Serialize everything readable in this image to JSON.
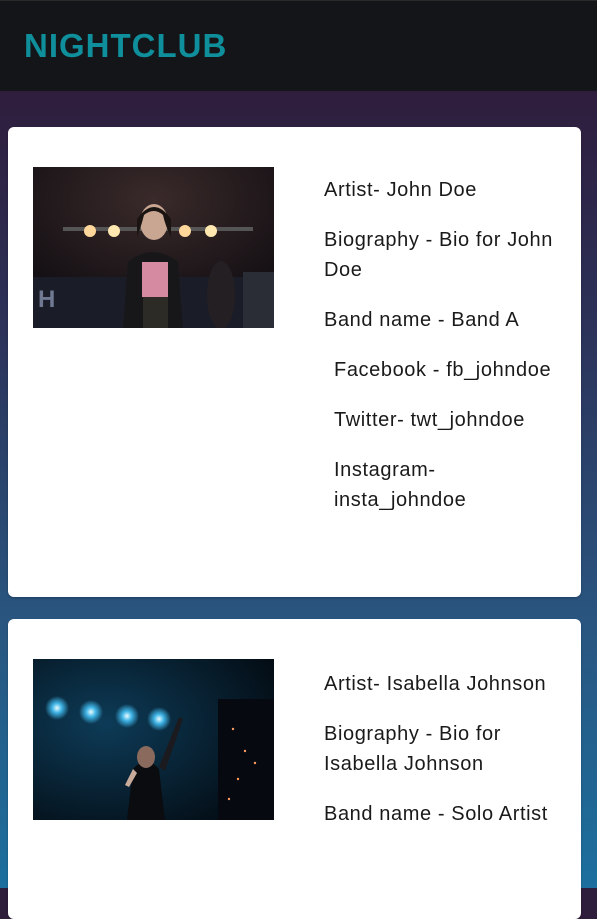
{
  "header": {
    "brand": "NIGHTCLUB"
  },
  "artists": [
    {
      "artist": "Artist- John Doe",
      "biography": "Biography - Bio for John Doe",
      "band": "Band name - Band A",
      "facebook": "Facebook - fb_johndoe",
      "twitter": "Twitter- twt_johndoe",
      "instagram": "Instagram- insta_johndoe",
      "photo_icon": "concert-performer-photo"
    },
    {
      "artist": "Artist- Isabella Johnson",
      "biography": "Biography - Bio for Isabella Johnson",
      "band": "Band name - Solo Artist",
      "photo_icon": "stage-singer-photo"
    }
  ],
  "colors": {
    "brand": "#0f8f9b",
    "header_bg": "#141518",
    "card_bg": "#ffffff"
  }
}
